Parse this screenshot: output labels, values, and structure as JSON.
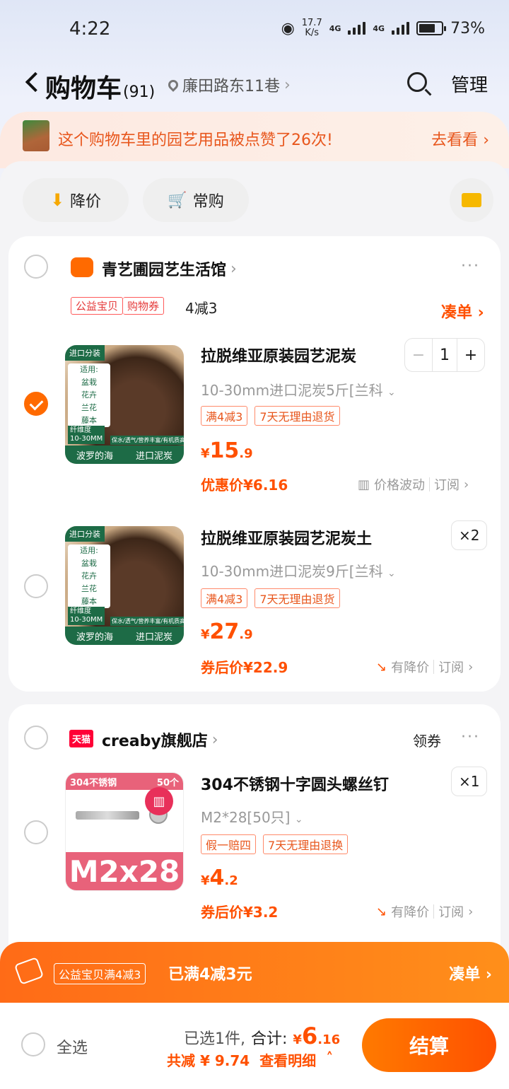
{
  "status": {
    "time": "4:22",
    "net_speed": "17.7\nK/s",
    "net1": "4G",
    "net2": "4G",
    "battery": "73%"
  },
  "header": {
    "title": "购物车",
    "count": "(91)",
    "location": "廉田路东11巷",
    "manage": "管理"
  },
  "banner": {
    "text": "这个购物车里的园艺用品被点赞了26次!",
    "link": "去看看"
  },
  "chips": {
    "price_drop": "降价",
    "frequent": "常购"
  },
  "store1": {
    "name": "青艺圃园艺生活馆",
    "tags": [
      "公益宝贝",
      "购物券"
    ],
    "promo": "4减3",
    "collect": "凑单",
    "items": [
      {
        "name": "拉脱维亚原装园艺泥炭",
        "spec": "10-30mm进口泥炭5斤[兰科",
        "tags": [
          "满4减3",
          "7天无理由退货"
        ],
        "price_int": "15",
        "price_dec": ".9",
        "discount": "优惠价¥6.16",
        "trend": "价格波动",
        "subscribe": "订阅",
        "qty": "1",
        "img_top": "进口分装",
        "img_left": [
          "适用:",
          "盆栽",
          "花卉",
          "兰花",
          "藤本"
        ],
        "img_size": [
          "纤维度",
          "10-30MM"
        ],
        "img_caption": "保水/透气/营养丰富/有机质高",
        "img_bar": [
          "波罗的海",
          "进口泥炭"
        ]
      },
      {
        "name": "拉脱维亚原装园艺泥炭土",
        "spec": "10-30mm进口泥炭9斤[兰科",
        "tags": [
          "满4减3",
          "7天无理由退货"
        ],
        "price_int": "27",
        "price_dec": ".9",
        "discount": "券后价¥22.9",
        "trend": "有降价",
        "subscribe": "订阅",
        "qty": "×2",
        "img_top": "进口分装",
        "img_left": [
          "适用:",
          "盆栽",
          "花卉",
          "兰花",
          "藤本"
        ],
        "img_size": [
          "纤维度",
          "10-30MM"
        ],
        "img_caption": "保水/透气/营养丰富/有机质高",
        "img_bar": [
          "波罗的海",
          "进口泥炭"
        ]
      }
    ]
  },
  "store2": {
    "badge": "天猫",
    "name": "creaby旗舰店",
    "coupon": "领券",
    "item": {
      "name": "304不锈钢十字圆头螺丝钉",
      "spec": "M2*28[50只]",
      "tags": [
        "假一赔四",
        "7天无理由退换"
      ],
      "price_int": "4",
      "price_dec": ".2",
      "discount": "券后价¥3.2",
      "trend": "有降价",
      "subscribe": "订阅",
      "qty": "×1",
      "img_top": "304不锈钢",
      "img_count": "50个",
      "img_big": "M2x28"
    }
  },
  "promo_bar": {
    "tag": "公益宝贝满4减3",
    "text": "已满4减3元",
    "link": "凑单"
  },
  "footer": {
    "select_all": "全选",
    "selected": "已选1件,",
    "total_label": "合计:",
    "total_int": "6",
    "total_dec": ".16",
    "saved": "共减 ¥ 9.74",
    "detail": "查看明细",
    "checkout": "结算"
  },
  "colors": {
    "accent": "#ff5000",
    "banner_text": "#e8561c"
  }
}
